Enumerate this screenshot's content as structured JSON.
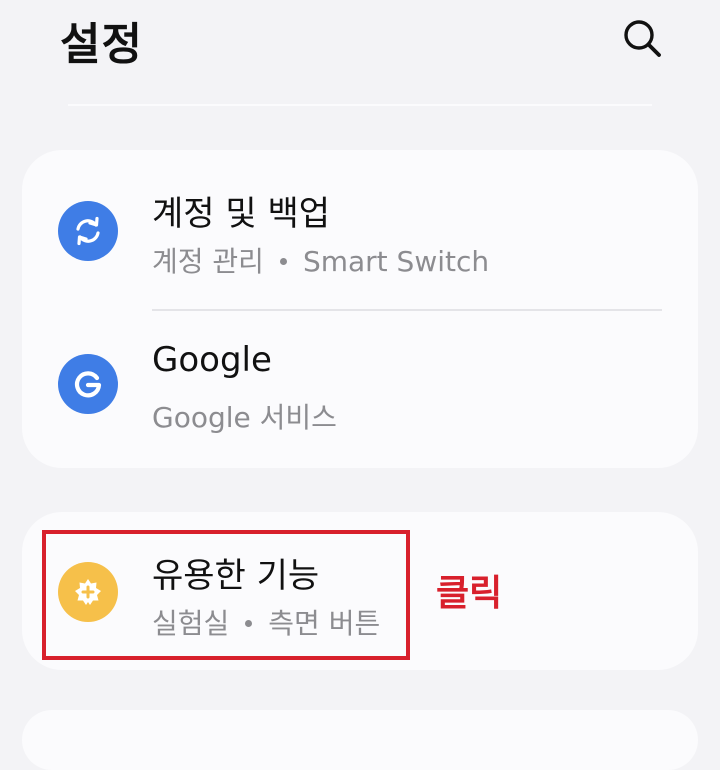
{
  "header": {
    "title": "설정",
    "search_icon": "search-icon"
  },
  "sections": [
    {
      "items": [
        {
          "title": "계정 및 백업",
          "subtitle_parts": [
            "계정 관리",
            "Smart Switch"
          ],
          "icon": "sync-icon",
          "icon_color": "#3f7de6"
        },
        {
          "title": "Google",
          "subtitle": "Google 서비스",
          "icon": "google-icon",
          "icon_color": "#3f7de6"
        }
      ]
    },
    {
      "items": [
        {
          "title": "유용한 기능",
          "subtitle_parts": [
            "실험실",
            "측면 버튼"
          ],
          "icon": "advanced-features-icon",
          "icon_color": "#f6c04a"
        }
      ]
    }
  ],
  "annotation": {
    "text": "클릭",
    "color": "#d8202c"
  }
}
